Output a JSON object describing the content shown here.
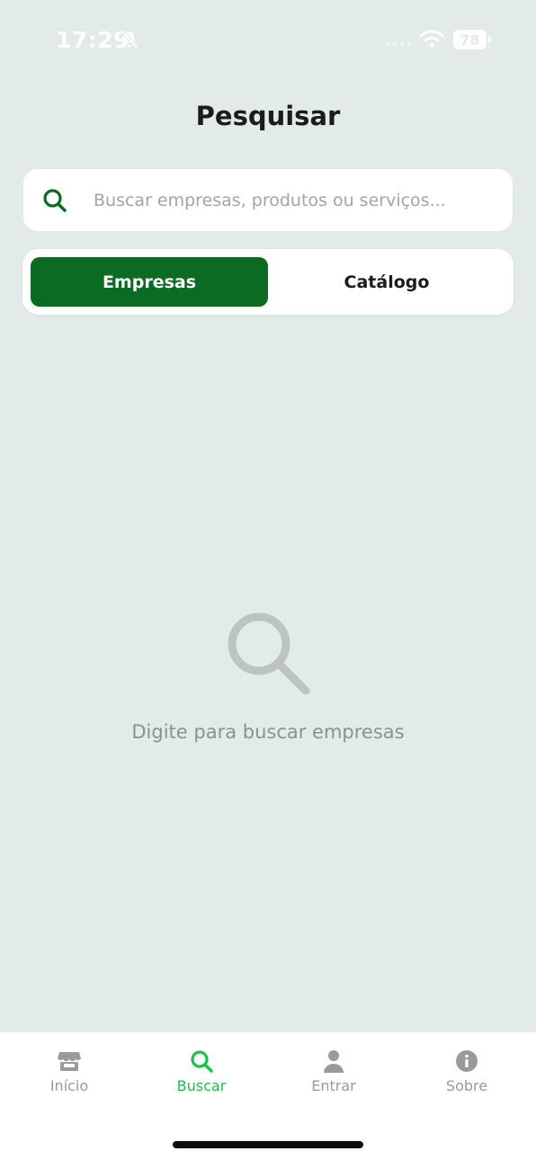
{
  "status_bar": {
    "time": "17:29",
    "battery": "78"
  },
  "header": {
    "title": "Pesquisar"
  },
  "search": {
    "placeholder": "Buscar empresas, produtos ou serviços...",
    "value": "",
    "icon": "search-icon"
  },
  "segments": {
    "active": "Empresas",
    "inactive": "Catálogo"
  },
  "empty_state": {
    "icon": "search-icon",
    "message": "Digite para buscar empresas"
  },
  "tab_bar": {
    "items": [
      {
        "label": "Início",
        "icon": "store-icon"
      },
      {
        "label": "Buscar",
        "icon": "search-icon",
        "active": true
      },
      {
        "label": "Entrar",
        "icon": "user-icon"
      },
      {
        "label": "Sobre",
        "icon": "info-icon"
      }
    ]
  },
  "colors": {
    "accent": "#0b6b23",
    "tab_active": "#1cc14d",
    "background": "#e3ebe8"
  }
}
